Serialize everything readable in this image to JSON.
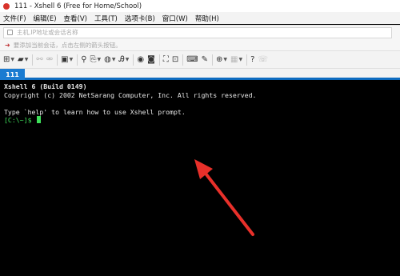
{
  "window": {
    "title": "111 - Xshell 6 (Free for Home/School)"
  },
  "menu": [
    "文件(F)",
    "编辑(E)",
    "查看(V)",
    "工具(T)",
    "选项卡(B)",
    "窗口(W)",
    "帮助(H)"
  ],
  "address_bar": {
    "placeholder": "主机,IP地址或会话名称"
  },
  "hint_bar": {
    "text": "要添加当前会话，点击左侧的箭头按钮。"
  },
  "toolbar": {
    "icons": [
      "new-session-icon",
      "open-folder-icon",
      "connect-icon",
      "disconnect-icon",
      "properties-icon",
      "find-icon",
      "copy-icon",
      "globe-icon",
      "font-icon",
      "xftp-icon",
      "xmanager-icon",
      "fullscreen-icon",
      "lock-icon",
      "keyboard-icon",
      "compose-icon",
      "add-tab-icon",
      "layout-icon",
      "help-icon",
      "chat-icon"
    ]
  },
  "tabs": [
    {
      "label": "111",
      "active": true
    }
  ],
  "terminal": {
    "lines": [
      {
        "text": "Xshell 6 (Build 0149)",
        "bold": true
      },
      {
        "text": "Copyright (c) 2002 NetSarang Computer, Inc. All rights reserved.",
        "bold": false
      },
      {
        "text": "",
        "bold": false
      },
      {
        "text": "Type `help' to learn how to use Xshell prompt.",
        "bold": false
      }
    ],
    "prompt": "[C:\\~]$ ",
    "colors": {
      "background": "#000000",
      "text": "#e6e6e6",
      "prompt": "#3ee05a"
    }
  },
  "annotation": {
    "color": "#e8302a"
  }
}
